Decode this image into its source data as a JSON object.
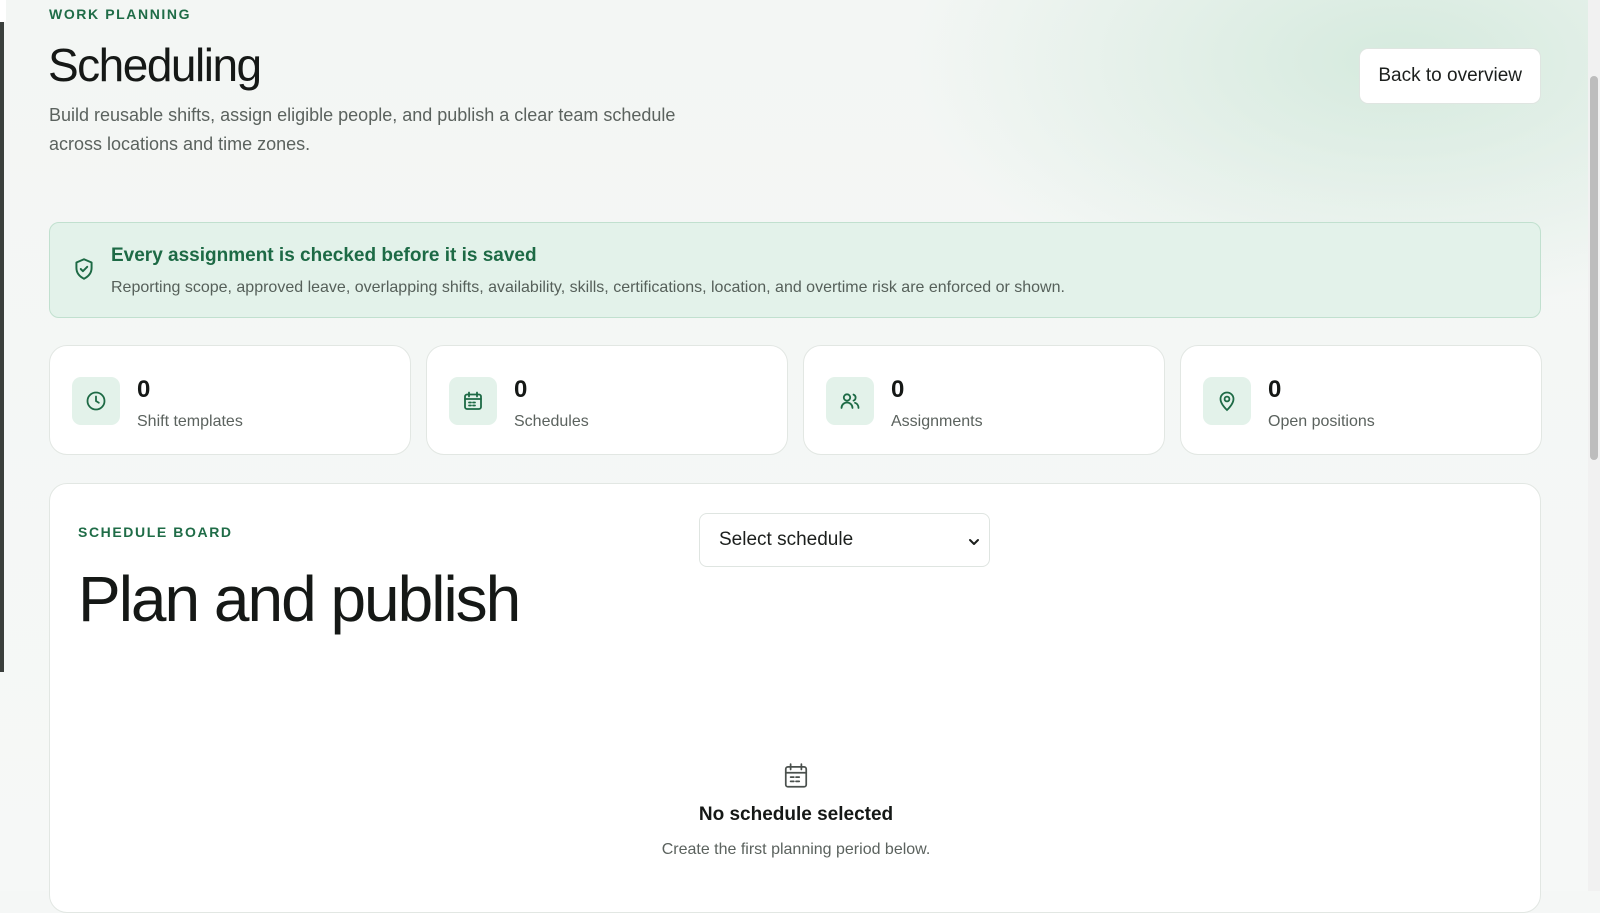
{
  "header": {
    "eyebrow": "WORK PLANNING",
    "title": "Scheduling",
    "description": "Build reusable shifts, assign eligible people, and publish a clear team schedule across locations and time zones.",
    "back_button": "Back to overview"
  },
  "notice": {
    "icon": "shield-check-icon",
    "title": "Every assignment is checked before it is saved",
    "text": "Reporting scope, approved leave, overlapping shifts, availability, skills, certifications, location, and overtime risk are enforced or shown."
  },
  "stats": [
    {
      "icon": "clock-icon",
      "value": "0",
      "label": "Shift templates"
    },
    {
      "icon": "calendar-icon",
      "value": "0",
      "label": "Schedules"
    },
    {
      "icon": "users-icon",
      "value": "0",
      "label": "Assignments"
    },
    {
      "icon": "map-pin-icon",
      "value": "0",
      "label": "Open positions"
    }
  ],
  "board": {
    "eyebrow": "SCHEDULE BOARD",
    "title": "Plan and publish",
    "select_value": "Select schedule",
    "empty_icon": "calendar-icon",
    "empty_title": "No schedule selected",
    "empty_text": "Create the first planning period below."
  },
  "colors": {
    "accent": "#1f6c47",
    "accent_soft": "#e3f2ea",
    "text": "#151816",
    "muted": "#5b625e"
  }
}
